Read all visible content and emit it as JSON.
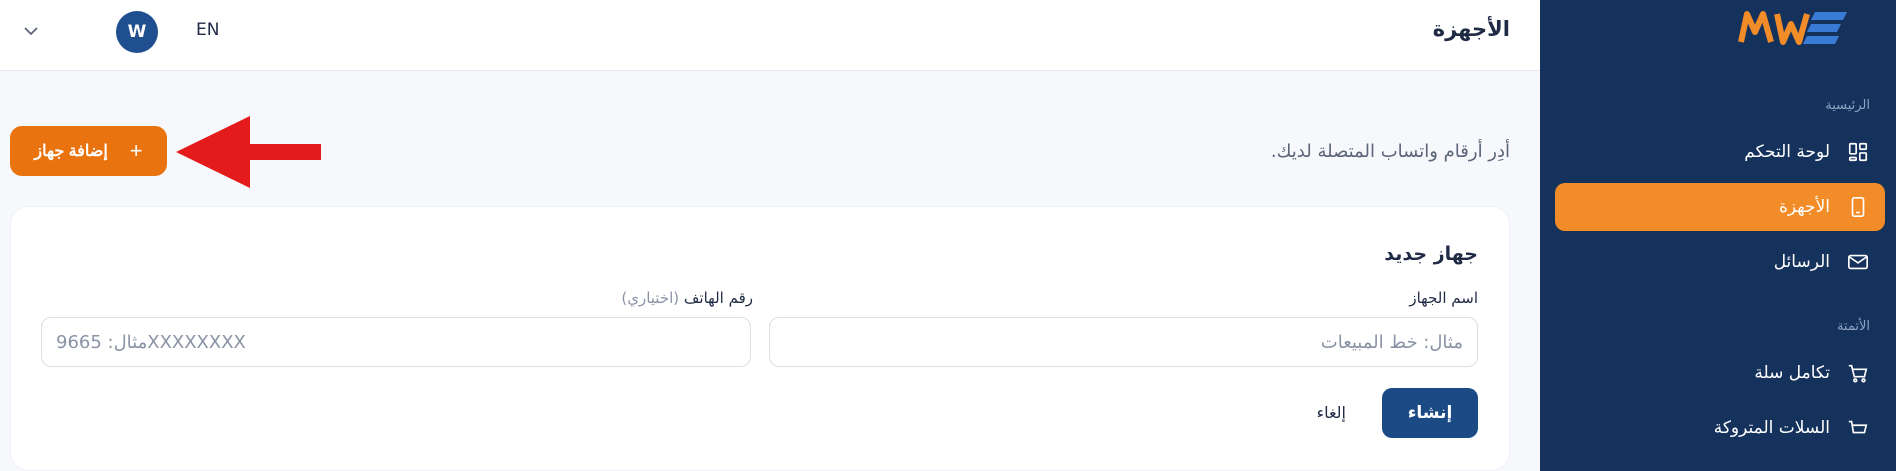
{
  "sidebar": {
    "logo_text": "MWE",
    "sections": [
      {
        "label": "الرئيسية"
      },
      {
        "label": "الأتمتة"
      }
    ],
    "items": [
      {
        "label": "لوحة التحكم",
        "icon": "dashboard-icon",
        "active": false
      },
      {
        "label": "الأجهزة",
        "icon": "phone-icon",
        "active": true
      },
      {
        "label": "الرسائل",
        "icon": "mail-icon",
        "active": false
      },
      {
        "label": "تكامل سلة",
        "icon": "cart-icon",
        "active": false
      },
      {
        "label": "السلات المتروكة",
        "icon": "basket-icon",
        "active": false
      }
    ]
  },
  "header": {
    "title": "الأجهزة",
    "lang": "EN",
    "avatar_initial": "W"
  },
  "main": {
    "subtitle": "أدِر أرقام واتساب المتصلة لديك.",
    "add_button_label": "إضافة جهاز",
    "card": {
      "title": "جهاز جديد",
      "device_name_label": "اسم الجهاز",
      "device_name_placeholder": "مثال: خط المبيعات",
      "phone_label": "رقم الهاتف",
      "phone_optional": "(اختياري)",
      "phone_placeholder": "مثال: 9665XXXXXXXX",
      "create_label": "إنشاء",
      "cancel_label": "إلغاء"
    }
  },
  "colors": {
    "sidebar_bg": "#15325c",
    "accent_orange": "#f28c28",
    "primary_blue": "#1c4a84",
    "annotation_arrow": "#e31b1b"
  }
}
